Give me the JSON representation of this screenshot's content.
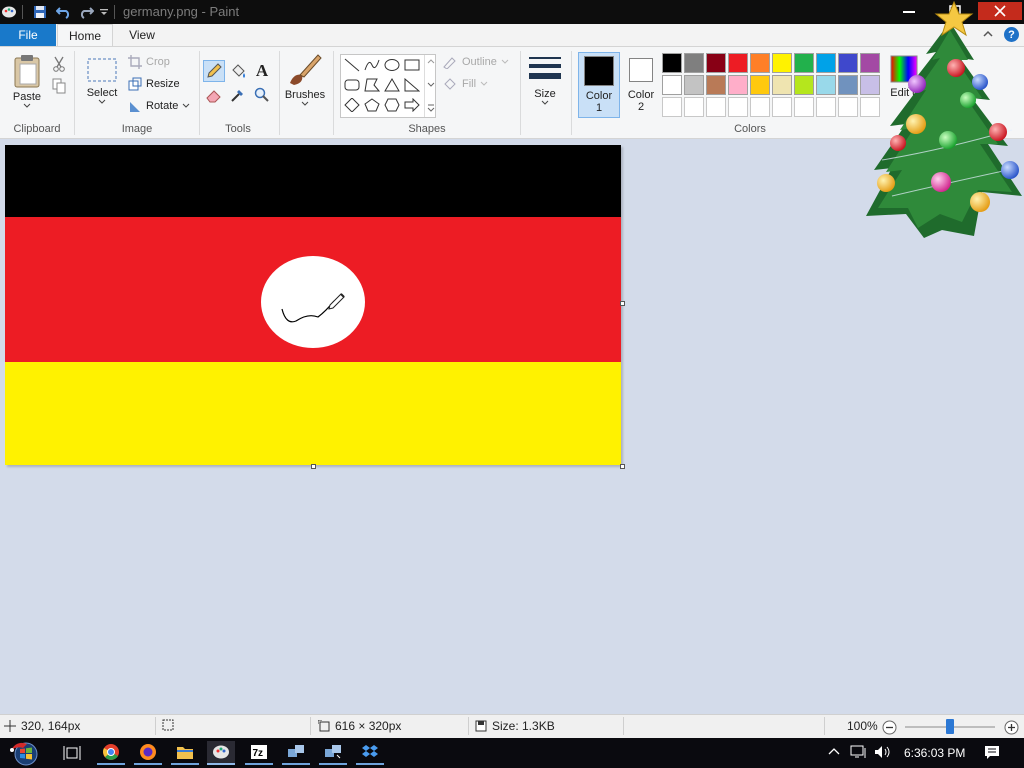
{
  "window": {
    "title": "germany.png - Paint"
  },
  "tabs": {
    "file": "File",
    "home": "Home",
    "view": "View"
  },
  "ribbon": {
    "clipboard": {
      "label": "Clipboard",
      "paste": "Paste"
    },
    "image": {
      "label": "Image",
      "select": "Select",
      "crop": "Crop",
      "resize": "Resize",
      "rotate": "Rotate"
    },
    "tools": {
      "label": "Tools"
    },
    "brushes": {
      "label": "Brushes"
    },
    "shapes": {
      "label": "Shapes",
      "outline": "Outline",
      "fill": "Fill"
    },
    "size": {
      "label": "Size"
    },
    "colors": {
      "label": "Colors",
      "color1_line1": "Color",
      "color1_line2": "1",
      "color2_line1": "Color",
      "color2_line2": "2",
      "color1_value": "#000000",
      "color2_value": "#ffffff",
      "edit_colors": "Edit c",
      "palette_row1": [
        "#000000",
        "#7f7f7f",
        "#880015",
        "#ed1c24",
        "#ff7f27",
        "#fff200",
        "#22b14c",
        "#00a2e8",
        "#3f48cc",
        "#a349a4"
      ],
      "palette_row2": [
        "#ffffff",
        "#c3c3c3",
        "#b97a57",
        "#ffaec9",
        "#ffc90e",
        "#efe4b0",
        "#b5e61d",
        "#99d9ea",
        "#7092be",
        "#c8bfe7"
      ],
      "palette_row3": [
        "#ffffff",
        "#ffffff",
        "#ffffff",
        "#ffffff",
        "#ffffff",
        "#ffffff",
        "#ffffff",
        "#ffffff",
        "#ffffff",
        "#ffffff"
      ]
    }
  },
  "canvas_image": {
    "stripe_colors": [
      "#000000",
      "#ed1c24",
      "#fff200"
    ]
  },
  "statusbar": {
    "cursor_position": "320, 164px",
    "selection_size": "",
    "image_size": "616 × 320px",
    "file_size": "Size: 1.3KB",
    "zoom": "100%",
    "zoom_level_percent": 100
  },
  "taskbar": {
    "clock": "6:36:03 PM"
  }
}
